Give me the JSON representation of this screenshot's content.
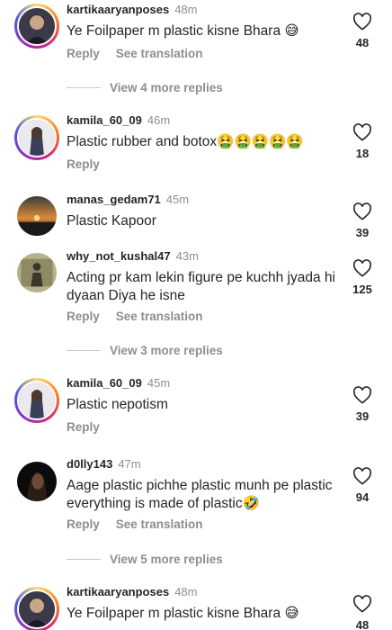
{
  "comments": [
    {
      "username": "kartikaaryanposes",
      "time": "48m",
      "text": "Ye Foilpaper m plastic kisne Bhara 😅",
      "likes": "48",
      "reply": "Reply",
      "translate": "See translation"
    },
    {
      "username": "kamila_60_09",
      "time": "46m",
      "text": "Plastic rubber and botox🤮🤮🤮🤮🤮",
      "likes": "18",
      "reply": "Reply"
    },
    {
      "username": "manas_gedam71",
      "time": "45m",
      "text": "Plastic Kapoor",
      "likes": "39"
    },
    {
      "username": "why_not_kushal47",
      "time": "43m",
      "text": "Acting pr kam lekin figure pe kuchh jyada hi dyaan Diya he isne",
      "likes": "125",
      "reply": "Reply",
      "translate": "See translation"
    },
    {
      "username": "kamila_60_09",
      "time": "45m",
      "text": "Plastic nepotism",
      "likes": "39",
      "reply": "Reply"
    },
    {
      "username": "d0lly143",
      "time": "47m",
      "text": "Aage plastic pichhe plastic munh pe plastic everything is made of plastic🤣",
      "likes": "94",
      "reply": "Reply",
      "translate": "See translation"
    },
    {
      "username": "kartikaaryanposes",
      "time": "48m",
      "text": "Ye Foilpaper m plastic kisne Bhara 😅",
      "likes": "48"
    }
  ],
  "more_replies": [
    "View 4 more replies",
    "View 3 more replies",
    "View 5 more replies"
  ],
  "icons": {
    "like": "heart-outline-icon"
  },
  "colors": {
    "secondary_text": "#8e8e8e",
    "primary_text": "#262626"
  }
}
